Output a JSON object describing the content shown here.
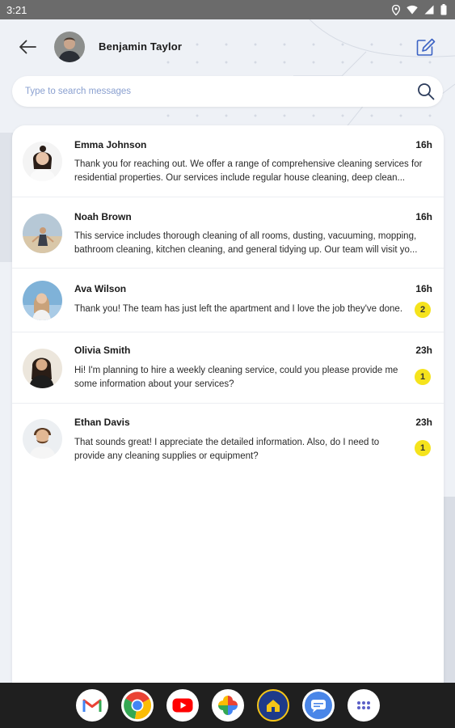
{
  "status_bar": {
    "time": "3:21",
    "icons": [
      "location-icon",
      "wifi-icon",
      "signal-icon",
      "battery-icon"
    ]
  },
  "header": {
    "back_icon": "arrow-left-icon",
    "user_name": "Benjamin Taylor",
    "compose_icon": "edit-icon"
  },
  "search": {
    "placeholder": "Type to search messages",
    "icon": "search-icon"
  },
  "conversations": [
    {
      "name": "Emma Johnson",
      "time": "16h",
      "preview": "Thank you for reaching out. We offer a range of comprehensive cleaning services for residential properties. Our services include regular house cleaning, deep clean...",
      "unread": null
    },
    {
      "name": "Noah Brown",
      "time": "16h",
      "preview": "This service includes thorough cleaning of all rooms, dusting, vacuuming, mopping, bathroom cleaning, kitchen cleaning, and general tidying up. Our team will visit yo...",
      "unread": null
    },
    {
      "name": "Ava Wilson",
      "time": "16h",
      "preview": "Thank you! The team has just left the apartment and I love the job they've done.",
      "unread": "2"
    },
    {
      "name": "Olivia Smith",
      "time": "23h",
      "preview": "Hi! I'm planning to hire a weekly cleaning service, could you please provide me some information about your services?",
      "unread": "1"
    },
    {
      "name": "Ethan Davis",
      "time": "23h",
      "preview": "That sounds great! I appreciate the detailed information. Also, do I need to provide any cleaning supplies or equipment?",
      "unread": "1"
    }
  ],
  "dock": {
    "apps": [
      "gmail-icon",
      "chrome-icon",
      "youtube-icon",
      "photos-icon",
      "home-app-icon",
      "messages-icon",
      "app-drawer-icon"
    ]
  },
  "colors": {
    "badge": "#f5e31c",
    "accent": "#3b62c4",
    "placeholder": "#8aa0d0"
  }
}
